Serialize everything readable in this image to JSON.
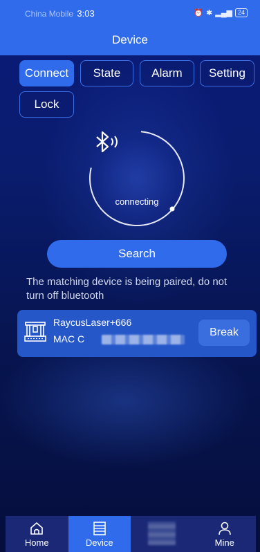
{
  "status_bar": {
    "carrier": "China Mobile",
    "time": "3:03",
    "battery": "24"
  },
  "header": {
    "title": "Device"
  },
  "tabs": [
    {
      "label": "Connect",
      "active": true
    },
    {
      "label": "State",
      "active": false
    },
    {
      "label": "Alarm",
      "active": false
    },
    {
      "label": "Setting",
      "active": false
    },
    {
      "label": "Lock",
      "active": false
    }
  ],
  "connection": {
    "status_text": "connecting",
    "icon": "bluetooth-icon"
  },
  "search_button": {
    "label": "Search"
  },
  "hint": "The matching device is being paired, do not turn off bluetooth",
  "device": {
    "name": "RaycusLaser+666",
    "mac_prefix": "MAC C",
    "icon": "laser-machine-icon",
    "action_label": "Break"
  },
  "bottom_nav": [
    {
      "label": "Home",
      "icon": "home-icon",
      "active": false
    },
    {
      "label": "Device",
      "icon": "device-list-icon",
      "active": true
    },
    {
      "label": "",
      "icon": "redacted",
      "active": false
    },
    {
      "label": "Mine",
      "icon": "person-icon",
      "active": false
    }
  ],
  "colors": {
    "accent": "#2f6bea",
    "background": "#0a1a7a",
    "card": "#2557c9"
  }
}
